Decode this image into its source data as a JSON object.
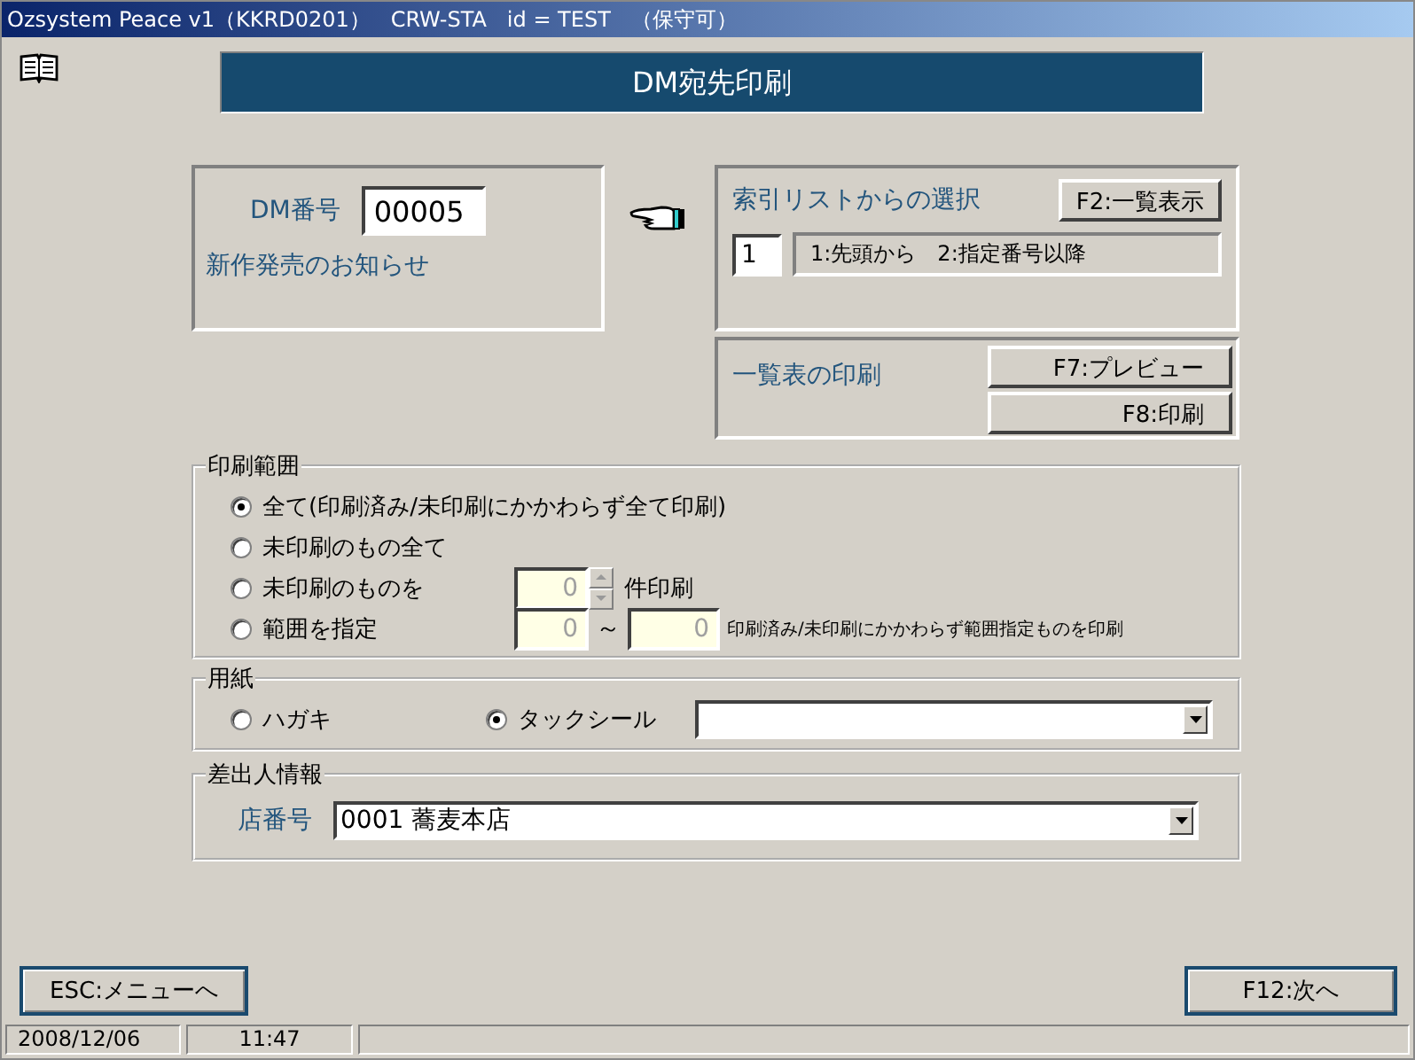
{
  "window": {
    "title": "Ozsystem Peace v1（KKRD0201）   CRW-STA   id = TEST   （保守可）"
  },
  "header": {
    "title": "DM宛先印刷"
  },
  "dm_panel": {
    "label": "DM番号",
    "value": "00005",
    "description": "新作発売のお知らせ"
  },
  "index_panel": {
    "label": "索引リストからの選択",
    "button": "F2:一覧表示",
    "mode_value": "1",
    "mode_hint": "1:先頭から　2:指定番号以降"
  },
  "list_print": {
    "label": "一覧表の印刷",
    "buttons": [
      "F7:プレビュー",
      "F8:印刷"
    ]
  },
  "print_range": {
    "legend": "印刷範囲",
    "options": [
      {
        "kind": "plain",
        "label": "全て(印刷済み/未印刷にかかわらず全て印刷)",
        "selected": true
      },
      {
        "kind": "plain",
        "label": "未印刷のもの全て",
        "selected": false
      },
      {
        "kind": "count",
        "label": "未印刷のものを",
        "selected": false,
        "count": "0",
        "suffix": "件印刷"
      },
      {
        "kind": "range",
        "label": "範囲を指定",
        "selected": false,
        "from": "0",
        "separator": "～",
        "to": "0",
        "note": "印刷済み/未印刷にかかわらず範囲指定ものを印刷"
      }
    ]
  },
  "paper": {
    "legend": "用紙",
    "options": [
      {
        "label": "ハガキ",
        "selected": false
      },
      {
        "label": "タックシール",
        "selected": true
      }
    ]
  },
  "sender": {
    "legend": "差出人情報",
    "label": "店番号",
    "value": "0001 蕎麦本店"
  },
  "footer_buttons": [
    "ESC:メニューへ",
    "F12:次へ"
  ],
  "status_bar": [
    "2008/12/06",
    "11:47"
  ]
}
